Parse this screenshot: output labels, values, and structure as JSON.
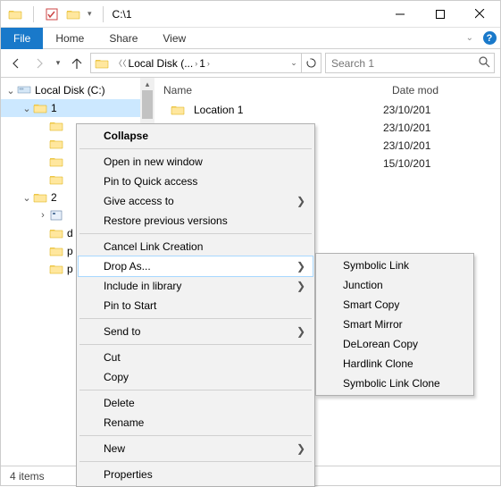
{
  "window": {
    "path": "C:\\1"
  },
  "ribbon": {
    "file": "File",
    "tabs": [
      "Home",
      "Share",
      "View"
    ]
  },
  "nav": {
    "breadcrumb": [
      "Local Disk (...",
      "1"
    ],
    "search_placeholder": "Search 1"
  },
  "tree": {
    "root": {
      "label": "Local Disk (C:)",
      "expanded": true
    },
    "items": [
      {
        "label": "1",
        "selected": true,
        "expanded": true,
        "indent": 1
      },
      {
        "label": "",
        "indent": 2
      },
      {
        "label": "",
        "indent": 2
      },
      {
        "label": "",
        "indent": 2
      },
      {
        "label": "",
        "indent": 2
      },
      {
        "label": "2",
        "expanded": true,
        "indent": 1
      },
      {
        "label": "",
        "expandable": true,
        "indent": 2,
        "icon": "app"
      },
      {
        "label": "d",
        "indent": 2
      },
      {
        "label": "p",
        "indent": 2
      },
      {
        "label": "p",
        "indent": 2
      }
    ]
  },
  "list": {
    "columns": {
      "name": "Name",
      "date": "Date mod"
    },
    "rows": [
      {
        "name": "Location 1",
        "date": "23/10/201"
      },
      {
        "name": "",
        "date": "23/10/201"
      },
      {
        "name": "",
        "date": "23/10/201"
      },
      {
        "name": "",
        "date": "15/10/201"
      }
    ]
  },
  "status": "4 items",
  "context_menu": {
    "items": [
      {
        "label": "Collapse",
        "bold": true
      },
      {
        "sep": true
      },
      {
        "label": "Open in new window"
      },
      {
        "label": "Pin to Quick access"
      },
      {
        "label": "Give access to",
        "sub": true
      },
      {
        "label": "Restore previous versions"
      },
      {
        "sep": true
      },
      {
        "label": "Cancel Link Creation"
      },
      {
        "label": "Drop As...",
        "sub": true,
        "hover": true
      },
      {
        "label": "Include in library",
        "sub": true
      },
      {
        "label": "Pin to Start"
      },
      {
        "sep": true
      },
      {
        "label": "Send to",
        "sub": true
      },
      {
        "sep": true
      },
      {
        "label": "Cut"
      },
      {
        "label": "Copy"
      },
      {
        "sep": true
      },
      {
        "label": "Delete"
      },
      {
        "label": "Rename"
      },
      {
        "sep": true
      },
      {
        "label": "New",
        "sub": true
      },
      {
        "sep": true
      },
      {
        "label": "Properties"
      }
    ]
  },
  "submenu": {
    "items": [
      {
        "label": "Symbolic Link"
      },
      {
        "label": "Junction"
      },
      {
        "label": "Smart Copy"
      },
      {
        "label": "Smart Mirror"
      },
      {
        "label": "DeLorean Copy"
      },
      {
        "label": "Hardlink Clone"
      },
      {
        "label": "Symbolic Link Clone"
      }
    ]
  }
}
